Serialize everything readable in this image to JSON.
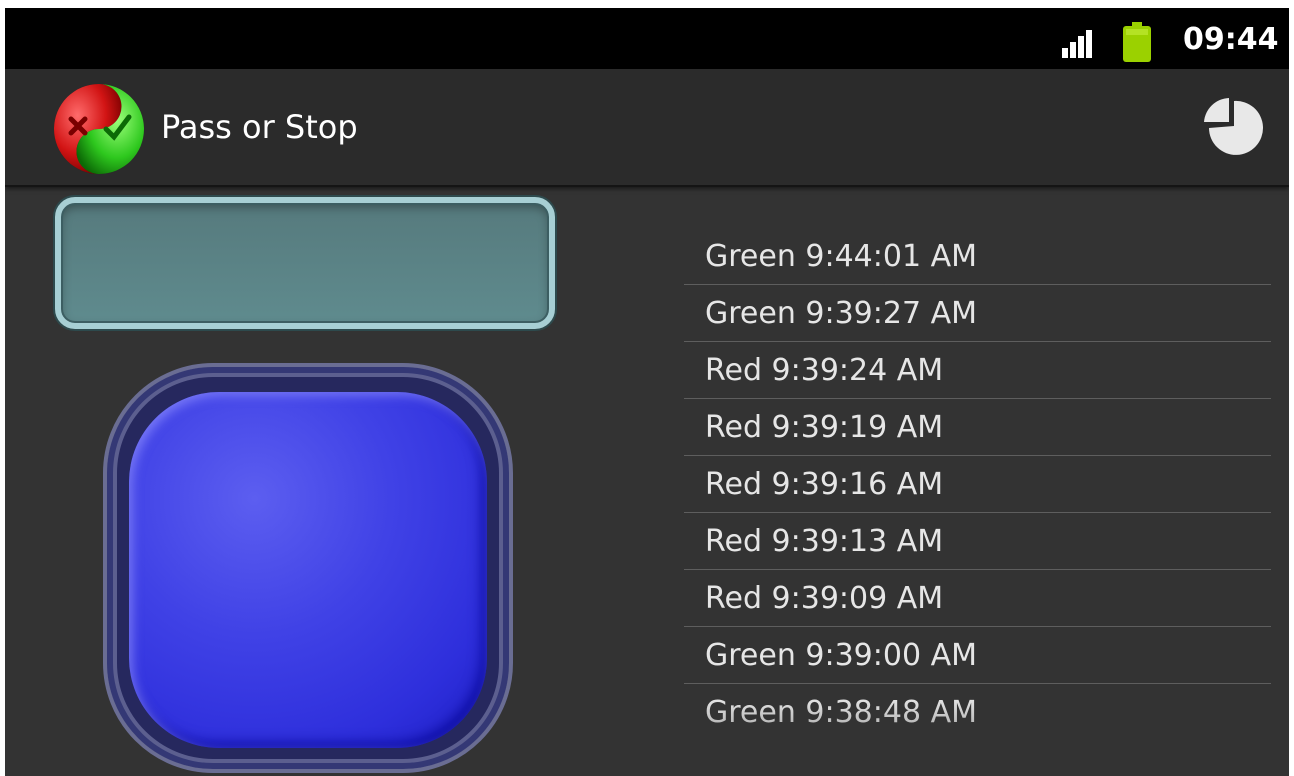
{
  "status_bar": {
    "time": "09:44",
    "signal_icon": "signal-bars-icon",
    "battery_icon": "battery-icon",
    "battery_color": "#9bd100"
  },
  "action_bar": {
    "title": "Pass or Stop",
    "logo_icon": "pass-stop-logo",
    "stats_icon": "pie-chart-icon"
  },
  "colors": {
    "display_fill": "#5c8588",
    "button_fill": "#3b3de0",
    "screen_background": "#333333"
  },
  "history": {
    "items": [
      "Green 9:44:01 AM",
      "Green 9:39:27 AM",
      "Red 9:39:24 AM",
      "Red 9:39:19 AM",
      "Red 9:39:16 AM",
      "Red 9:39:13 AM",
      "Red 9:39:09 AM",
      "Green 9:39:00 AM",
      "Green 9:38:48 AM"
    ]
  }
}
